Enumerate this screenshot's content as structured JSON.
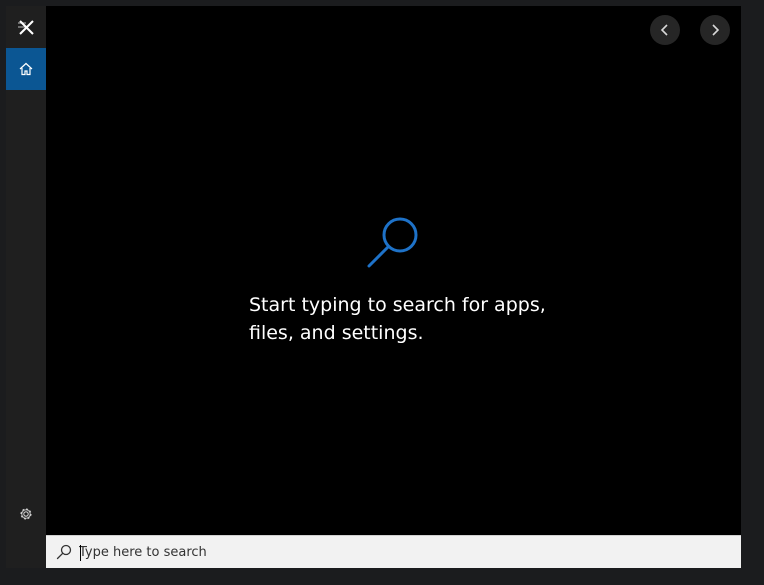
{
  "rail": {
    "items": [
      {
        "name": "menu-close",
        "icon": "close-icon"
      },
      {
        "name": "home",
        "icon": "home-icon",
        "selected": true
      },
      {
        "name": "settings",
        "icon": "gear-icon"
      }
    ],
    "accent": "#0b5693"
  },
  "main": {
    "nav": {
      "back_icon": "chevron-left-icon",
      "forward_icon": "chevron-right-icon"
    },
    "hero_icon": "search-icon",
    "hero_icon_color": "#1e72c8",
    "message_line1": "Start typing to search for apps,",
    "message_line2": "files, and settings."
  },
  "search": {
    "icon": "search-icon",
    "placeholder": "Type here to search",
    "value": ""
  }
}
